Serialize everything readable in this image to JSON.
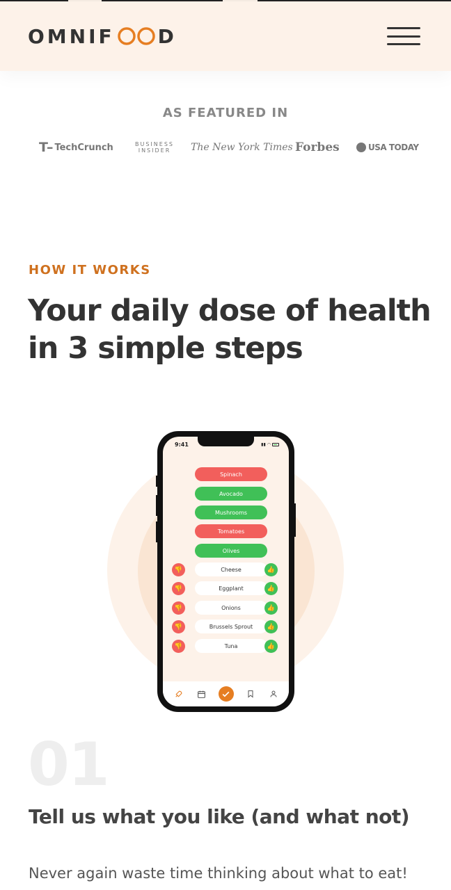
{
  "brand": {
    "name_left": "OMNIF",
    "name_right": "D",
    "accent": "#e67e22",
    "bg": "#fdf2e9"
  },
  "nav": {
    "menu_icon": "hamburger-menu-icon"
  },
  "featured": {
    "title": "AS FEATURED IN",
    "logos": [
      {
        "mark": "T–",
        "text": "TechCrunch"
      },
      {
        "line1": "BUSINESS",
        "line2": "INSIDER"
      },
      {
        "text": "The New York Times"
      },
      {
        "text": "Forbes"
      },
      {
        "text": "USA TODAY"
      }
    ]
  },
  "how": {
    "subheading": "HOW IT WORKS",
    "heading": "Your daily dose of health in 3 simple steps"
  },
  "app": {
    "time": "9:41",
    "selected": [
      {
        "label": "Spinach",
        "status": "disliked",
        "color": "#f25f5c"
      },
      {
        "label": "Avocado",
        "status": "liked",
        "color": "#40c057"
      },
      {
        "label": "Mushrooms",
        "status": "liked",
        "color": "#40c057"
      },
      {
        "label": "Tomatoes",
        "status": "disliked",
        "color": "#f25f5c"
      },
      {
        "label": "Olives",
        "status": "liked",
        "color": "#40c057"
      }
    ],
    "options": [
      {
        "label": "Cheese"
      },
      {
        "label": "Eggplant"
      },
      {
        "label": "Onions"
      },
      {
        "label": "Brussels Sprout"
      },
      {
        "label": "Tuna"
      }
    ],
    "tabs": [
      "rocket-icon",
      "calendar-icon",
      "check-icon",
      "bookmark-icon",
      "user-icon"
    ]
  },
  "step": {
    "number": "01",
    "title": "Tell us what you like (and what not)",
    "description": "Never again waste time thinking about what to eat!"
  }
}
